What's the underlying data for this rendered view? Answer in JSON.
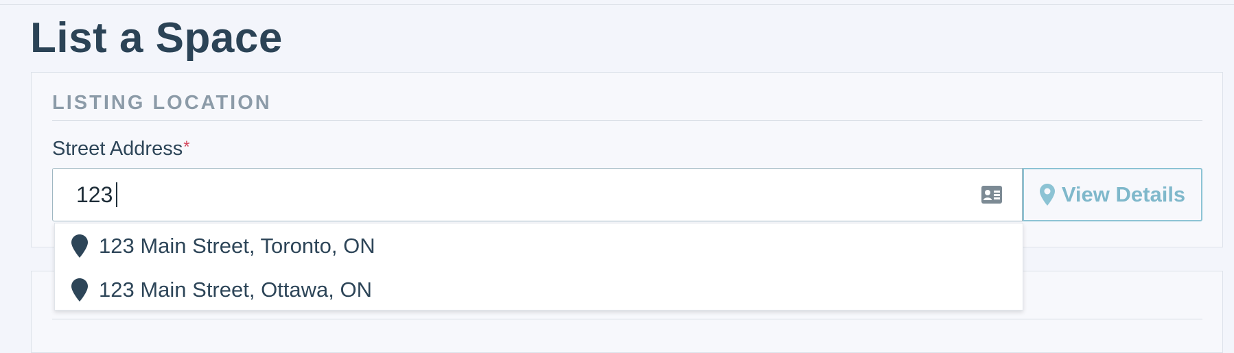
{
  "page": {
    "title": "List a Space"
  },
  "location_section": {
    "heading": "Listing Location",
    "street_address": {
      "label": "Street Address",
      "required_marker": "*",
      "value": "123",
      "icon": "contact-card-icon"
    },
    "view_details_button": {
      "label": "View Details",
      "icon": "map-pin-icon"
    },
    "suggestions": [
      {
        "text": "123 Main Street, Toronto, ON",
        "icon": "map-pin-icon"
      },
      {
        "text": "123 Main Street, Ottawa, ON",
        "icon": "map-pin-icon"
      }
    ]
  },
  "colors": {
    "title": "#2b4356",
    "heading_muted": "#8c9ba8",
    "required": "#d5475e",
    "accent": "#7fb8cb",
    "input_border": "#9fb7c2",
    "background": "#f3f5fb"
  }
}
